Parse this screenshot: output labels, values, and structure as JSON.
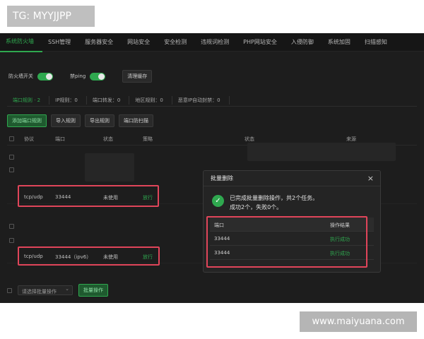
{
  "watermarks": {
    "top": "TG: MYYJJPP",
    "bottom": "www.maiyuana.com"
  },
  "nav": [
    "系统防火墙",
    "SSH管理",
    "服务器安全",
    "网站安全",
    "安全检测",
    "违规词检测",
    "PHP网站安全",
    "入侵防御",
    "系统加固",
    "扫描感知"
  ],
  "toggles": {
    "firewall_label": "防火墙开关",
    "ping_label": "禁ping",
    "clear_cache": "清理缓存"
  },
  "tabs": [
    "端口规则 · 2",
    "IP规则：0",
    "端口转发：0",
    "地区规则：0",
    "恶意IP自动封禁：0"
  ],
  "actions": [
    "添加端口规则",
    "导入规则",
    "导出规则",
    "端口防扫描"
  ],
  "table": {
    "headers": {
      "protocol": "协议",
      "port": "端口",
      "status": "状态",
      "policy": "策略",
      "state": "状态",
      "source": "来源"
    },
    "rows": [
      {
        "protocol": "tcp/udp",
        "port": "33444",
        "status": "未使用",
        "policy": "放行"
      },
      {
        "protocol": "tcp/udp",
        "port": "33444（ipv6）",
        "status": "未使用",
        "policy": "放行"
      }
    ]
  },
  "bottom": {
    "select_placeholder": "请选择批量操作",
    "batch_button": "批量操作"
  },
  "modal": {
    "title": "批量删除",
    "close": "×",
    "message_line1": "已完成批量删除操作，共2个任务。",
    "message_line2": "成功2个，失败0个。",
    "col_port": "端口",
    "col_result": "操作结果",
    "rows": [
      {
        "port": "33444",
        "result": "执行成功"
      },
      {
        "port": "33444",
        "result": "执行成功"
      }
    ]
  },
  "colors": {
    "accent": "#2fa84f",
    "highlight": "#e0455a",
    "background": "#1d1d1d"
  }
}
